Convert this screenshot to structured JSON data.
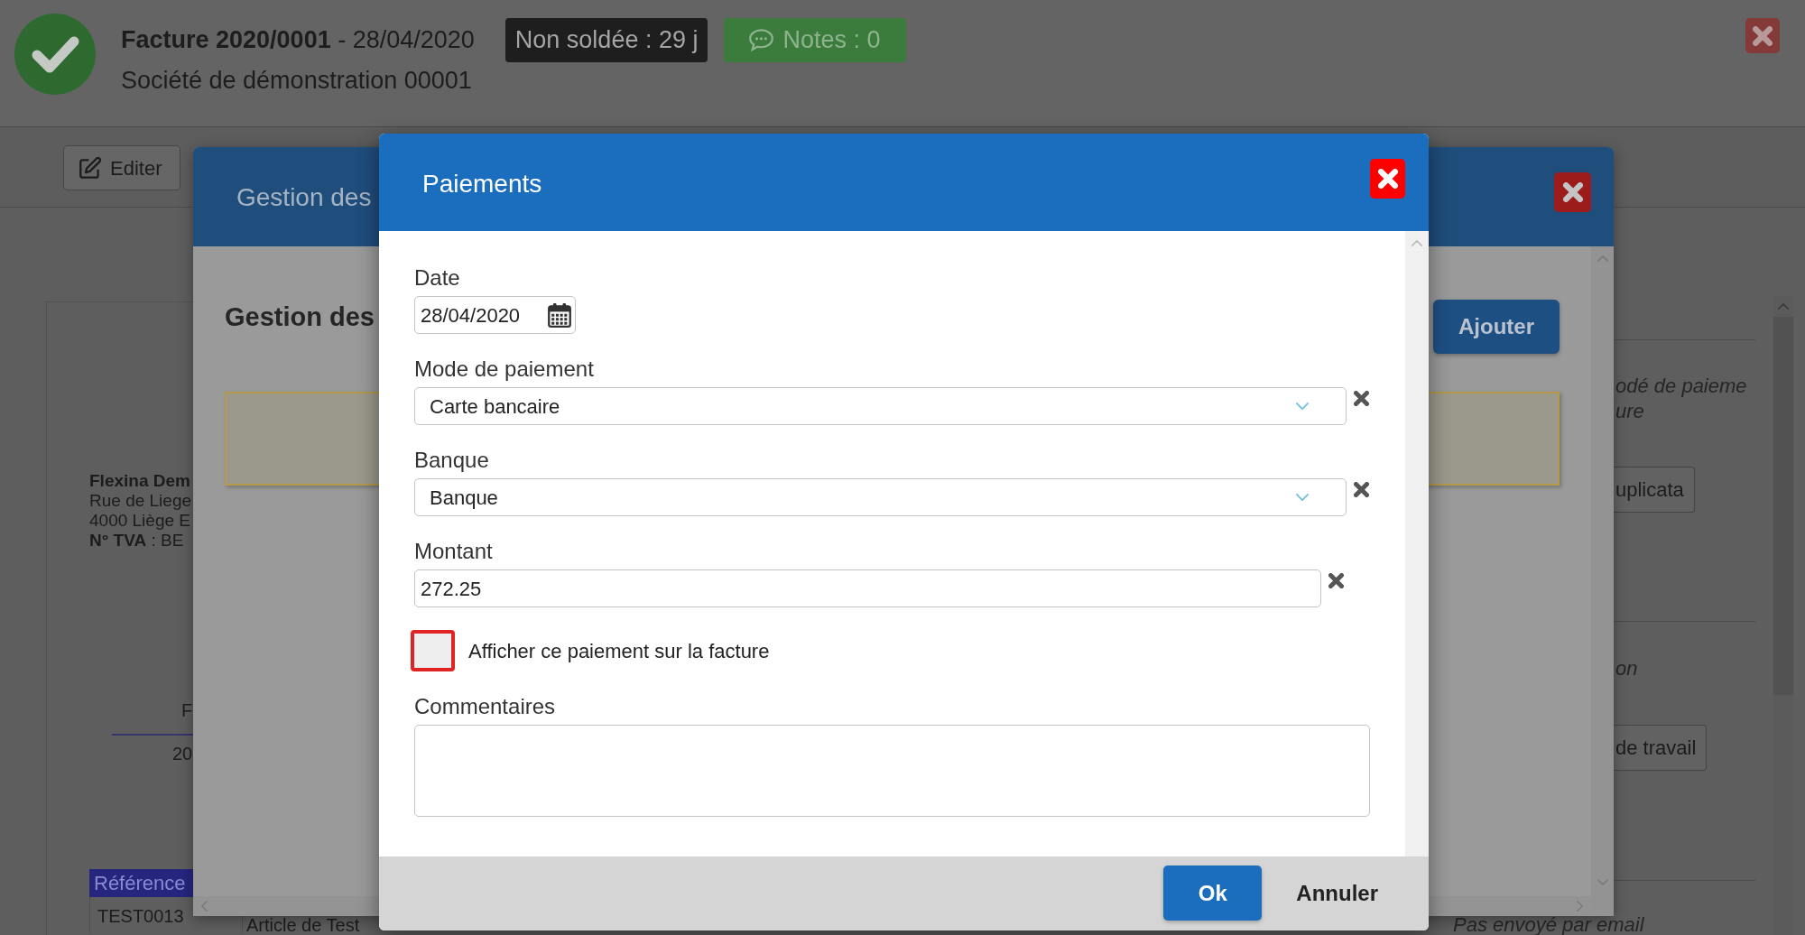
{
  "header": {
    "title": "**Facture 2020/0001** - 28/04/2020",
    "subtitle": "Société de démonstration 00001",
    "badges": [
      {
        "kind": "status",
        "text": "Non soldée : 29 j"
      },
      {
        "kind": "notes",
        "text": "Notes : 0"
      }
    ]
  },
  "toolbar": {
    "buttons": [
      "Editer"
    ]
  },
  "document": {
    "company": "Flexina Dem",
    "address": [
      "Rue de Liege",
      "4000 Liège E",
      "**N° TVA** : BE"
    ],
    "title": "F",
    "date": "20",
    "table": {
      "columns": [
        "Référence"
      ],
      "rows": [
        [
          "TEST0013",
          "Article de Test"
        ]
      ]
    }
  },
  "side_panel": {
    "sections": [
      {
        "lines": [
          "odé de paieme",
          "ure"
        ],
        "button": "uplicata"
      },
      {
        "lines": [
          "on"
        ],
        "button": "de travail"
      }
    ],
    "note": "Pas envoyé par email"
  },
  "background_dialog": {
    "title": "Gestion des",
    "heading": "Gestion des",
    "button": "Ajouter"
  },
  "dialog": {
    "title": "Paiements",
    "fields": [
      {
        "kind": "date",
        "label": "Date",
        "value": "28/04/2020"
      },
      {
        "kind": "select",
        "label": "Mode de paiement",
        "value": "Carte bancaire",
        "clearable": true
      },
      {
        "kind": "select",
        "label": "Banque",
        "value": "Banque",
        "clearable": true
      },
      {
        "kind": "text",
        "label": "Montant",
        "value": "272.25",
        "clearable": true
      },
      {
        "kind": "checkbox",
        "label": "Afficher ce paiement sur la facture",
        "checked": false
      },
      {
        "kind": "textarea",
        "label": "Commentaires"
      }
    ],
    "buttons": [
      {
        "kind": "primary",
        "label": "Ok"
      },
      {
        "kind": "plain",
        "label": "Annuler"
      }
    ]
  }
}
